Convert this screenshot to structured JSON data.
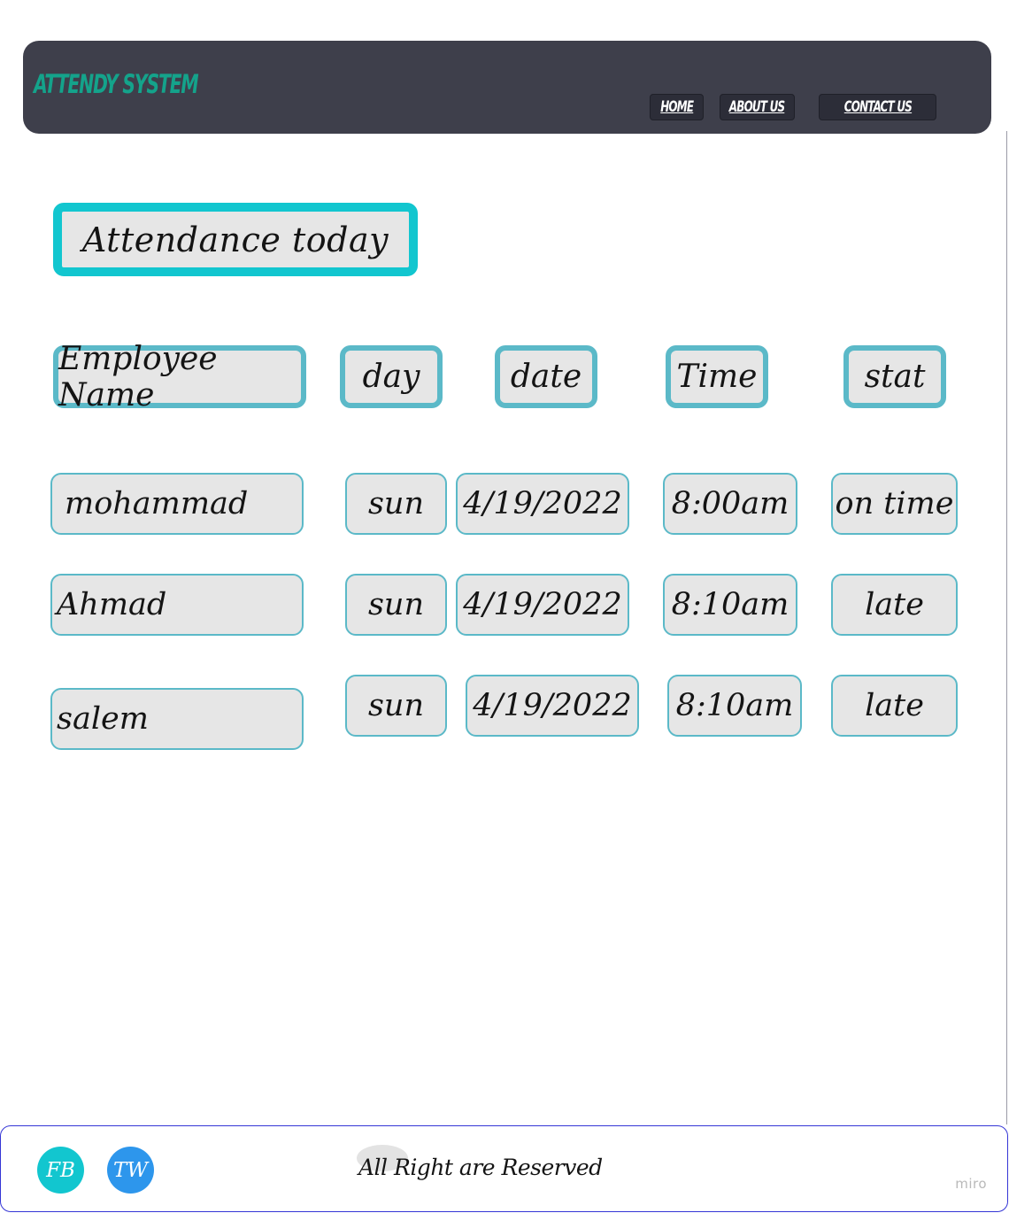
{
  "header": {
    "brand": "ATTENDY SYSTEM",
    "nav": [
      {
        "label": "HOME"
      },
      {
        "label": "ABOUT US"
      },
      {
        "label": "CONTACT US"
      }
    ]
  },
  "main": {
    "title": "Attendance today",
    "columns": [
      "Employee Name",
      "day",
      "date",
      "Time",
      "stat"
    ],
    "rows": [
      {
        "name": "mohammad",
        "day": "sun",
        "date": "4/19/2022",
        "time": "8:00am",
        "stat": "on time"
      },
      {
        "name": "Ahmad",
        "day": "sun",
        "date": "4/19/2022",
        "time": "8:10am",
        "stat": "late"
      },
      {
        "name": "salem",
        "day": "sun",
        "date": "4/19/2022",
        "time": "8:10am",
        "stat": "late"
      }
    ]
  },
  "footer": {
    "social": [
      {
        "label": "FB",
        "color": "#12c6cf"
      },
      {
        "label": "TW",
        "color": "#2d96ec"
      }
    ],
    "rights": "All Right are Reserved",
    "watermark": "miro"
  },
  "colors": {
    "header_bg": "#3e3f4b",
    "brand": "#14a38b",
    "accent": "#12c6cf",
    "cell_border": "#5bb9c8",
    "cell_bg": "#e6e6e6"
  }
}
